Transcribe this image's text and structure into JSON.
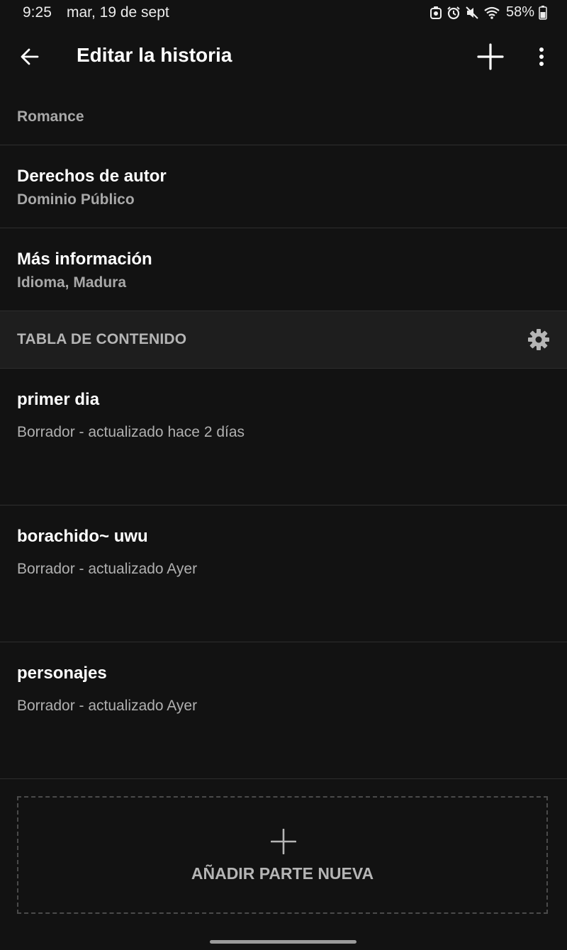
{
  "status_bar": {
    "time": "9:25",
    "date": "mar, 19 de sept",
    "battery": "58%",
    "icons": [
      "notification-icon",
      "alarm-icon",
      "mute-icon",
      "wifi-icon",
      "battery-icon"
    ]
  },
  "app_bar": {
    "title": "Editar la historia",
    "back_icon": "arrow-back-icon",
    "add_icon": "plus-icon",
    "more_icon": "more-vertical-icon"
  },
  "details": [
    {
      "title": "",
      "value": "Romance"
    },
    {
      "title": "Derechos de autor",
      "value": "Dominio Público"
    },
    {
      "title": "Más información",
      "value": "Idioma, Madura"
    }
  ],
  "toc": {
    "header": "TABLA DE CONTENIDO",
    "settings_icon": "gear-icon",
    "parts": [
      {
        "title": "primer dia",
        "status": "Borrador - actualizado hace 2 días"
      },
      {
        "title": "borachido~ uwu",
        "status": "Borrador - actualizado Ayer"
      },
      {
        "title": "personajes",
        "status": "Borrador - actualizado Ayer"
      }
    ]
  },
  "add_part": {
    "label": "AÑADIR PARTE NUEVA",
    "icon": "plus-icon"
  },
  "colors": {
    "background": "#121212",
    "header_background": "#1e1e1e",
    "divider": "#2e2e2e",
    "text_primary": "#ffffff",
    "text_secondary": "#b0b0b0"
  }
}
